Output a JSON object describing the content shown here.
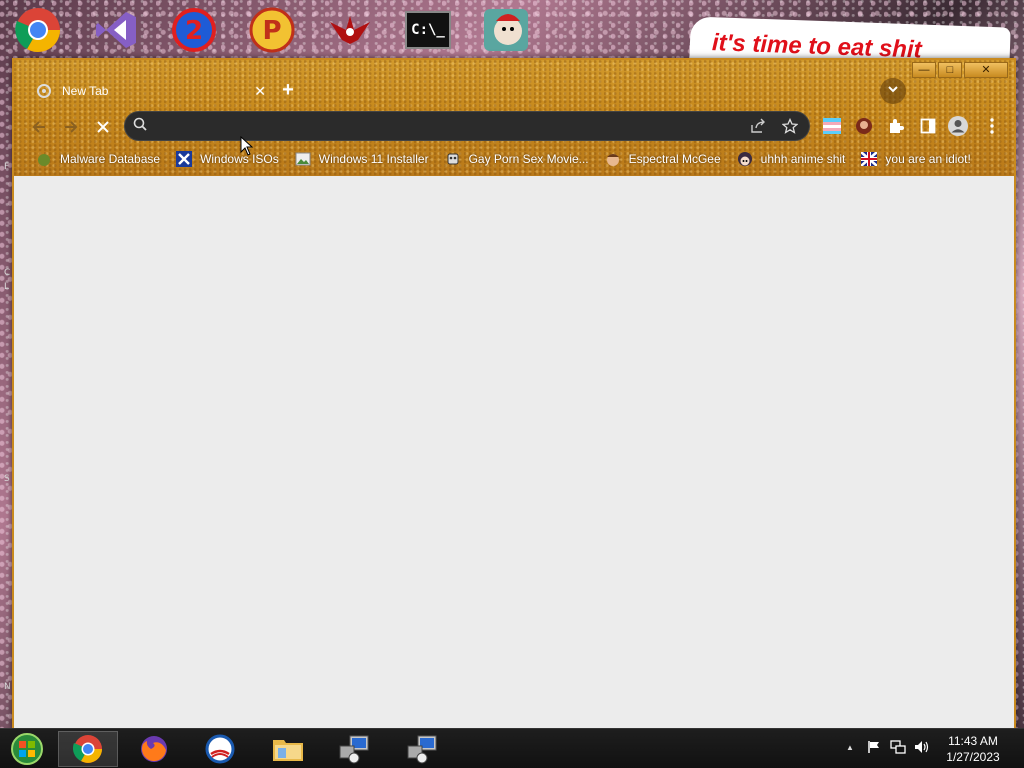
{
  "desktop": {
    "icons": [
      {
        "name": "chrome-icon"
      },
      {
        "name": "visual-studio-icon"
      },
      {
        "name": "number-2-icon"
      },
      {
        "name": "p-ball-icon"
      },
      {
        "name": "red-bird-icon"
      },
      {
        "name": "cmd-icon",
        "label": "C:\\_"
      },
      {
        "name": "cartoon-face-icon"
      }
    ],
    "banner_text": "it's time to eat shit",
    "left_edge_glyphs": [
      "F",
      "C",
      "L",
      "S",
      "N"
    ]
  },
  "window": {
    "tab": {
      "title": "New Tab",
      "close": "✕"
    },
    "new_tab_label": "+",
    "controls": {
      "minimize": "—",
      "maximize": "□",
      "close": "✕"
    },
    "omnibox": {
      "value": "",
      "placeholder": ""
    },
    "bookmarks": [
      {
        "label": "Malware Database",
        "icon": "green-blob-icon"
      },
      {
        "label": "Windows ISOs",
        "icon": "x-logo-icon"
      },
      {
        "label": "Windows 11 Installer",
        "icon": "image-icon"
      },
      {
        "label": "Gay Porn Sex Movie...",
        "icon": "robot-icon"
      },
      {
        "label": "Espectral McGee",
        "icon": "face-icon"
      },
      {
        "label": "uhhh anime shit",
        "icon": "anime-face-icon"
      },
      {
        "label": "you are an idiot!",
        "icon": "flag-icon"
      }
    ]
  },
  "taskbar": {
    "items": [
      {
        "name": "start-button"
      },
      {
        "name": "chrome-taskbar-icon",
        "active": true
      },
      {
        "name": "firefox-taskbar-icon"
      },
      {
        "name": "obama-logo-taskbar-icon"
      },
      {
        "name": "file-explorer-taskbar-icon"
      },
      {
        "name": "network-computer-taskbar-icon"
      },
      {
        "name": "network-computer-taskbar-icon-2"
      }
    ],
    "clock": {
      "time": "11:43 AM",
      "date": "1/27/2023"
    },
    "tray_up_arrow": "▲"
  },
  "colors": {
    "frame": "#c7891c",
    "page_bg": "#ececec",
    "omnibox_bg": "#2b2b2b",
    "banner_text": "#e0101a"
  }
}
